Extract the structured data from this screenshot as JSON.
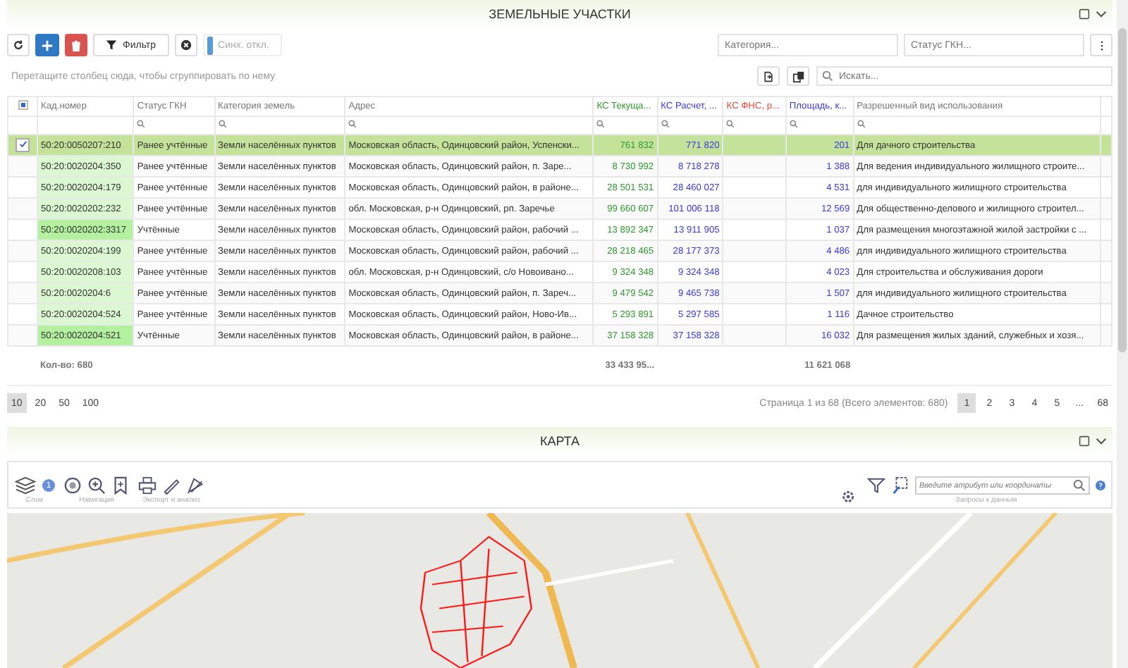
{
  "parcels_panel": {
    "title": "ЗЕМЕЛЬНЫЕ УЧАСТКИ",
    "toolbar": {
      "filter_button": "Фильтр",
      "sync_toggle": {
        "label": "Синх. откл.",
        "on": false
      },
      "category_field": {
        "placeholder": "Категория..."
      },
      "status_field": {
        "placeholder": "Статус ГКН..."
      }
    },
    "group_hint": "Перетащите столбец сюда, чтобы сгруппировать по нему",
    "search": {
      "placeholder": "Искать..."
    },
    "table": {
      "columns": [
        {
          "label": "Кад.номер",
          "kind": "text",
          "total": "Кол-во: 680"
        },
        {
          "label": "Статус ГКН",
          "kind": "text"
        },
        {
          "label": "Категория земель",
          "kind": "text"
        },
        {
          "label": "Адрес",
          "kind": "text"
        },
        {
          "label": "КС Текуща...",
          "kind": "number",
          "color": "#2e9a2e",
          "total": "33 433 95..."
        },
        {
          "label": "КС Расчет, ...",
          "kind": "number",
          "color": "#3a3adf"
        },
        {
          "label": "КС ФНС, р...",
          "kind": "number",
          "color": "#f0453a"
        },
        {
          "label": "Площадь, к...",
          "kind": "number",
          "color": "#3a3adf",
          "total": "11 621 068"
        },
        {
          "label": "Разрешенный вид использования",
          "kind": "text"
        }
      ],
      "select_all": {
        "indeterminate": true
      },
      "rows": [
        {
          "selected": true,
          "cells": [
            "50:20:0050207:210",
            "Ранее учтённые",
            "Земли населённых пунктов",
            "Московская область, Одинцовский район, Успенски...",
            "761 832",
            "771 820",
            "",
            "201",
            "Для дачного строительства"
          ]
        },
        {
          "selected": false,
          "color": "#dcf8d2",
          "cells": [
            "50:20:0020204:350",
            "Ранее учтённые",
            "Земли населённых пунктов",
            "Московская область, Одинцовский район, п. Заре...",
            "8 730 992",
            "8 718 278",
            "",
            "1 388",
            "Для ведения индивидуального жилищного строите..."
          ]
        },
        {
          "selected": false,
          "color": "#dcf8d2",
          "cells": [
            "50:20:0020204:179",
            "Ранее учтённые",
            "Земли населённых пунктов",
            "Московская область, Одинцовский район, в районе...",
            "28 501 531",
            "28 460 027",
            "",
            "4 531",
            "для индивидуального жилищного строительства"
          ]
        },
        {
          "selected": false,
          "color": "#dcf8d2",
          "cells": [
            "50:20:0020202:232",
            "Ранее учтённые",
            "Земли населённых пунктов",
            "обл. Московская, р-н Одинцовский, рп. Заречье",
            "99 660 607",
            "101 006 118",
            "",
            "12 569",
            "Для общественно-делового и жилищного строител..."
          ]
        },
        {
          "selected": false,
          "color": "#b3f0a0",
          "cells": [
            "50:20:0020202:3317",
            "Учтённые",
            "Земли населённых пунктов",
            "Московская область, Одинцовский район, рабочий ...",
            "13 892 347",
            "13 911 905",
            "",
            "1 037",
            "Для размещения многоэтажной жилой застройки с ..."
          ]
        },
        {
          "selected": false,
          "color": "#dcf8d2",
          "cells": [
            "50:20:0020204:199",
            "Ранее учтённые",
            "Земли населённых пунктов",
            "Московская область, Одинцовский район, рабочий ...",
            "28 218 465",
            "28 177 373",
            "",
            "4 486",
            "для индивидуального жилищного строительства"
          ]
        },
        {
          "selected": false,
          "color": "#dcf8d2",
          "cells": [
            "50:20:0020208:103",
            "Ранее учтённые",
            "Земли населённых пунктов",
            "обл. Московская, р-н Одинцовский, с/о Новоивано...",
            "9 324 348",
            "9 324 348",
            "",
            "4 023",
            "Для строительства и обслуживания дороги"
          ]
        },
        {
          "selected": false,
          "color": "#dcf8d2",
          "cells": [
            "50:20:0020204:6",
            "Ранее учтённые",
            "Земли населённых пунктов",
            "Московская область, Одинцовский район, п. Зареч...",
            "9 479 542",
            "9 465 738",
            "",
            "1 507",
            "для индивидуального жилищного строительства"
          ]
        },
        {
          "selected": false,
          "color": "#dcf8d2",
          "cells": [
            "50:20:0020204:524",
            "Ранее учтённые",
            "Земли населённых пунктов",
            "Московская область, Одинцовский район, Ново-Ив...",
            "5 293 891",
            "5 297 585",
            "",
            "1 116",
            "Дачное строительство"
          ]
        },
        {
          "selected": false,
          "color": "#b3f0a0",
          "cells": [
            "50:20:0020204:521",
            "Учтённые",
            "Земли населённых пунктов",
            "Московская область, Одинцовский район, в районе...",
            "37 158 328",
            "37 158 328",
            "",
            "16 032",
            "Для размещения жилых зданий, служебных и хозя..."
          ]
        }
      ]
    },
    "pager": {
      "sizes": [
        {
          "label": "10",
          "selected": true
        },
        {
          "label": "20",
          "selected": false
        },
        {
          "label": "50",
          "selected": false
        },
        {
          "label": "100",
          "selected": false
        }
      ],
      "info": "Страница 1 из 68 (Всего элементов: 680)",
      "pages": [
        {
          "label": "1",
          "selected": true
        },
        {
          "label": "2",
          "selected": false
        },
        {
          "label": "3",
          "selected": false
        },
        {
          "label": "4",
          "selected": false
        },
        {
          "label": "5",
          "selected": false
        },
        {
          "label": "...",
          "selected": false
        },
        {
          "label": "68",
          "selected": false
        }
      ]
    }
  },
  "map_panel": {
    "title": "КАРТА",
    "layers_badge": "1",
    "groups": [
      "Слои",
      "Навигация",
      "Экспорт и анализ",
      "Запросы к данным"
    ],
    "search": {
      "placeholder": "Введите атрибут или координаты"
    }
  }
}
